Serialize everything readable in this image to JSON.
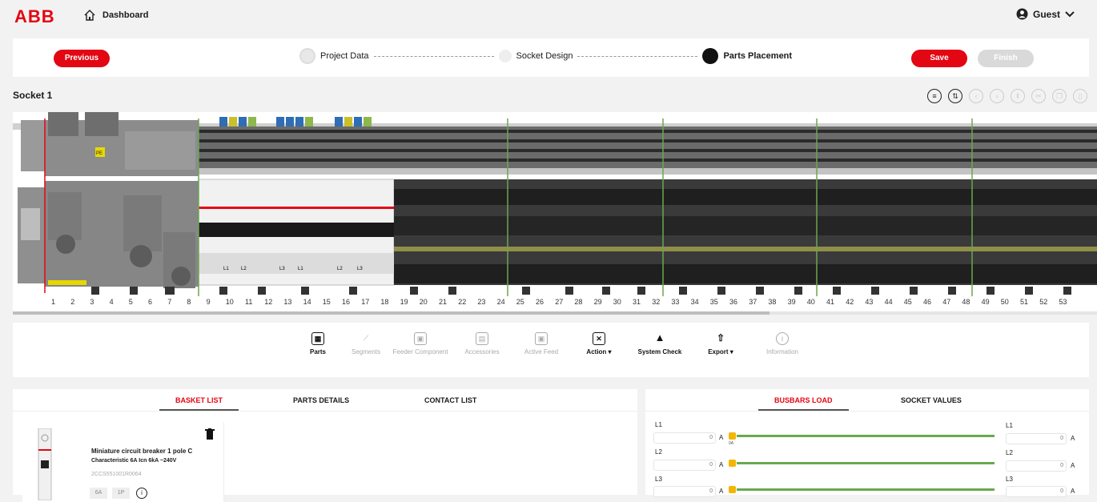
{
  "header": {
    "logo": "ABB",
    "dashboard_label": "Dashboard",
    "user_label": "Guest"
  },
  "stepper": {
    "previous_label": "Previous",
    "steps": [
      "Project Data",
      "Socket Design",
      "Parts Placement"
    ],
    "save_label": "Save",
    "finish_label": "Finish"
  },
  "socket": {
    "title": "Socket 1",
    "numbers": [
      "1",
      "2",
      "3",
      "4",
      "5",
      "6",
      "7",
      "8",
      "9",
      "10",
      "11",
      "12",
      "13",
      "14",
      "15",
      "16",
      "17",
      "18",
      "19",
      "20",
      "21",
      "22",
      "23",
      "24",
      "25",
      "26",
      "27",
      "28",
      "29",
      "30",
      "31",
      "32",
      "33",
      "34",
      "35",
      "36",
      "37",
      "38",
      "39",
      "40",
      "41",
      "42",
      "43",
      "44",
      "45",
      "46",
      "47",
      "48",
      "49",
      "50",
      "51",
      "52",
      "53"
    ],
    "breaker_labels": [
      "L1",
      "L2",
      "L3",
      "L1",
      "L2",
      "L3"
    ],
    "pe_label": "PE"
  },
  "actions": [
    {
      "label": "Parts",
      "icon": "parts-icon",
      "active": true
    },
    {
      "label": "Segments",
      "icon": "segments-icon",
      "active": false
    },
    {
      "label": "Feeder Component",
      "icon": "feeder-icon",
      "active": false
    },
    {
      "label": "Accessories",
      "icon": "accessories-icon",
      "active": false
    },
    {
      "label": "Active Feed",
      "icon": "active-feed-icon",
      "active": false
    },
    {
      "label": "Action",
      "icon": "action-icon",
      "active": true
    },
    {
      "label": "System Check",
      "icon": "warning-icon",
      "active": true
    },
    {
      "label": "Export",
      "icon": "export-icon",
      "active": true
    },
    {
      "label": "Information",
      "icon": "info-icon",
      "active": false
    }
  ],
  "left_panel": {
    "tabs": [
      "BASKET LIST",
      "PARTS DETAILS",
      "CONTACT LIST"
    ],
    "item": {
      "title": "Miniature circuit breaker 1 pole C",
      "subtitle": "Characteristic  6A Icn 6kA ~240V",
      "code": "2CCS551001R0064",
      "tags": [
        "6A",
        "1P"
      ]
    }
  },
  "right_panel": {
    "tabs": [
      "BUSBARS LOAD",
      "SOCKET VALUES"
    ],
    "rows": [
      {
        "label": "L1",
        "value": "0",
        "unit": "A",
        "marker": "0A",
        "right_label": "L1",
        "right_value": "0",
        "right_unit": "A"
      },
      {
        "label": "L2",
        "value": "0",
        "unit": "A",
        "right_label": "L2",
        "right_value": "0",
        "right_unit": "A"
      },
      {
        "label": "L3",
        "value": "0",
        "unit": "A",
        "right_label": "L3",
        "right_value": "0",
        "right_unit": "A"
      }
    ]
  },
  "colors": {
    "accent": "#e30613",
    "busbar": "#6aa84f",
    "marker": "#f4b400"
  }
}
